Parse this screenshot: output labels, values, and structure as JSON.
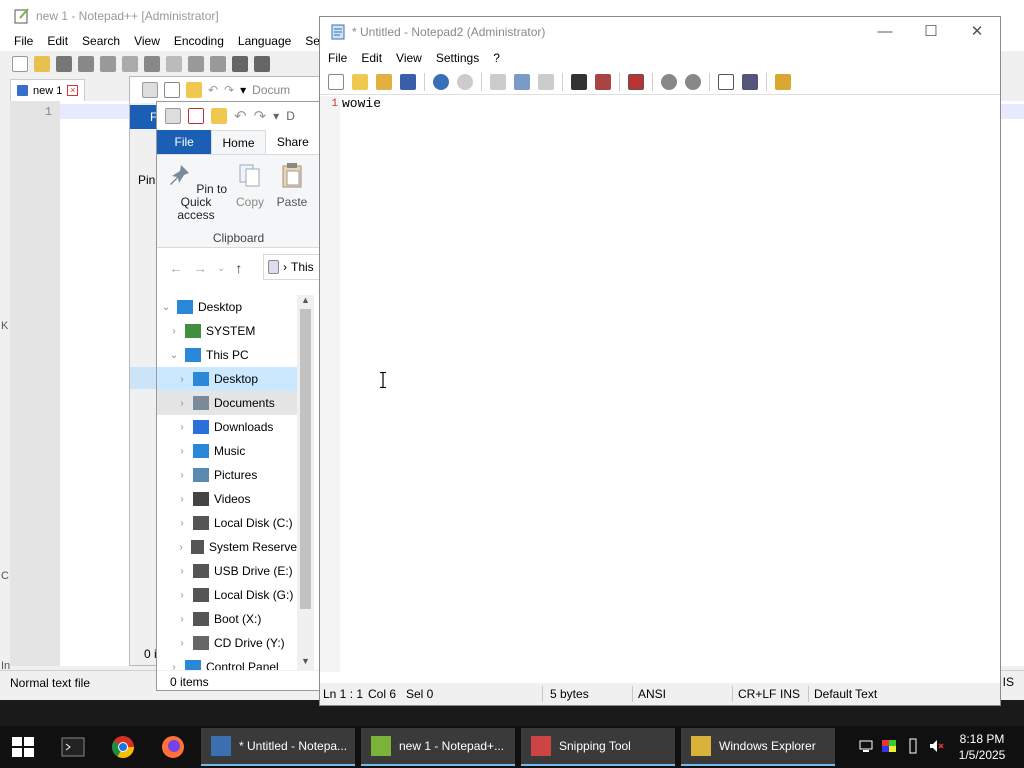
{
  "notepadpp": {
    "title": "new 1 - Notepad++ [Administrator]",
    "menu": [
      "File",
      "Edit",
      "Search",
      "View",
      "Encoding",
      "Language",
      "Setti"
    ],
    "tab_label": "new 1",
    "line_number": "1",
    "status_left": "Normal text file",
    "status_right": "IS",
    "edge_letters": [
      "K",
      "C",
      "In"
    ]
  },
  "explorer": {
    "qat_path": "Docum",
    "qat_path_front": "D",
    "ribbon_tabs": {
      "file": "File",
      "home": "Home",
      "share": "Share"
    },
    "commands": {
      "pin": "Pin to Quick access",
      "copy": "Copy",
      "paste": "Paste",
      "back_pin_label": "Pin"
    },
    "group_label": "Clipboard",
    "address": "This",
    "back_file_letter": "F",
    "tree": [
      {
        "label": "Desktop",
        "icon": "desktop-icon",
        "level": 0,
        "expanded": true,
        "color": "#2b88d8"
      },
      {
        "label": "SYSTEM",
        "icon": "user-icon",
        "level": 1,
        "expanded": false,
        "color": "#3f8f3f"
      },
      {
        "label": "This PC",
        "icon": "computer-icon",
        "level": 1,
        "expanded": true,
        "color": "#2b88d8"
      },
      {
        "label": "Desktop",
        "icon": "desktop-icon",
        "level": 2,
        "expanded": false,
        "color": "#2b88d8",
        "state": "selected"
      },
      {
        "label": "Documents",
        "icon": "documents-icon",
        "level": 2,
        "expanded": false,
        "color": "#7a8a9a",
        "state": "hover"
      },
      {
        "label": "Downloads",
        "icon": "download-icon",
        "level": 2,
        "expanded": false,
        "color": "#2b6fd8"
      },
      {
        "label": "Music",
        "icon": "music-icon",
        "level": 2,
        "expanded": false,
        "color": "#2b88d8"
      },
      {
        "label": "Pictures",
        "icon": "pictures-icon",
        "level": 2,
        "expanded": false,
        "color": "#5a8ab0"
      },
      {
        "label": "Videos",
        "icon": "videos-icon",
        "level": 2,
        "expanded": false,
        "color": "#444"
      },
      {
        "label": "Local Disk (C:)",
        "icon": "drive-icon",
        "level": 2,
        "expanded": false,
        "color": "#555"
      },
      {
        "label": "System Reserve",
        "icon": "drive-icon",
        "level": 2,
        "expanded": false,
        "color": "#555"
      },
      {
        "label": "USB Drive (E:)",
        "icon": "drive-icon",
        "level": 2,
        "expanded": false,
        "color": "#555"
      },
      {
        "label": "Local Disk (G:)",
        "icon": "drive-icon",
        "level": 2,
        "expanded": false,
        "color": "#555"
      },
      {
        "label": "Boot (X:)",
        "icon": "drive-icon",
        "level": 2,
        "expanded": false,
        "color": "#555"
      },
      {
        "label": "CD Drive (Y:)",
        "icon": "cd-drive-icon",
        "level": 2,
        "expanded": false,
        "color": "#666"
      },
      {
        "label": "Control Panel",
        "icon": "control-panel-icon",
        "level": 1,
        "expanded": false,
        "color": "#2b88d8"
      }
    ],
    "status": "0 items",
    "back_status": "0 i"
  },
  "notepad2": {
    "title": "* Untitled - Notepad2 (Administrator)",
    "menu": [
      "File",
      "Edit",
      "View",
      "Settings",
      "?"
    ],
    "line_number": "1",
    "text": "wowie",
    "status": {
      "position": "Ln 1 : 1",
      "col": "Col 6",
      "sel": "Sel 0",
      "size": "5 bytes",
      "encoding": "ANSI",
      "eol": "CR+LF",
      "mode": "INS",
      "scheme": "Default Text"
    },
    "window_buttons": {
      "minimize": "—",
      "maximize": "☐",
      "close": "✕"
    }
  },
  "taskbar": {
    "tasks": [
      {
        "label": "* Untitled - Notepa...",
        "icon": "notepad2-icon",
        "color": "#3a6fb0"
      },
      {
        "label": "new 1 - Notepad+...",
        "icon": "notepadpp-icon",
        "color": "#7bb33a"
      },
      {
        "label": "Snipping Tool",
        "icon": "snipping-tool-icon",
        "color": "#c44"
      },
      {
        "label": "Windows Explorer",
        "icon": "explorer-icon",
        "color": "#d8b23a"
      }
    ],
    "time": "8:18 PM",
    "date": "1/5/2025"
  },
  "colors": {
    "accent": "#1a5fb4",
    "selection": "#cce8ff",
    "taskbar": "#101010",
    "line_number_red": "#c0392b"
  }
}
